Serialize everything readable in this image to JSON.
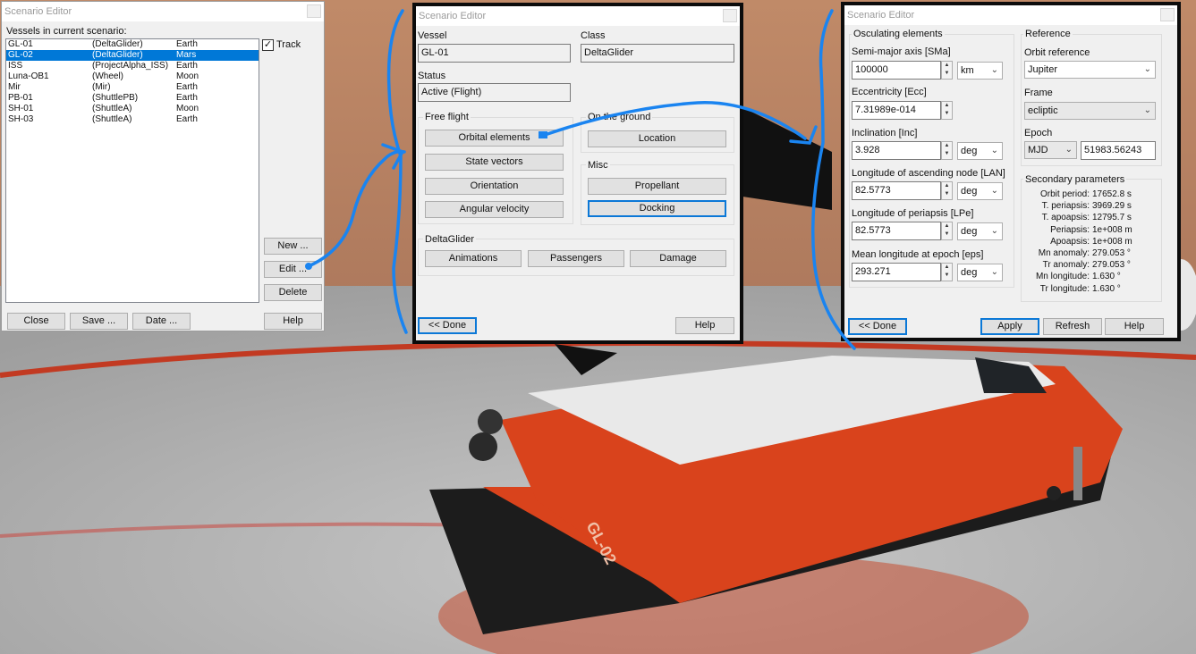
{
  "colors": {
    "accent": "#0078d7",
    "annotation": "#1a84f0",
    "hull": "#d9431c"
  },
  "dialog1": {
    "title": "Scenario Editor",
    "list_caption": "Vessels in current scenario:",
    "vessels": [
      {
        "name": "GL-01",
        "cls": "(DeltaGlider)",
        "body": "Earth",
        "selected": false
      },
      {
        "name": "GL-02",
        "cls": "(DeltaGlider)",
        "body": "Mars",
        "selected": true
      },
      {
        "name": "ISS",
        "cls": "(ProjectAlpha_ISS)",
        "body": "Earth",
        "selected": false
      },
      {
        "name": "Luna-OB1",
        "cls": "(Wheel)",
        "body": "Moon",
        "selected": false
      },
      {
        "name": "Mir",
        "cls": "(Mir)",
        "body": "Earth",
        "selected": false
      },
      {
        "name": "PB-01",
        "cls": "(ShuttlePB)",
        "body": "Earth",
        "selected": false
      },
      {
        "name": "SH-01",
        "cls": "(ShuttleA)",
        "body": "Moon",
        "selected": false
      },
      {
        "name": "SH-03",
        "cls": "(ShuttleA)",
        "body": "Earth",
        "selected": false
      }
    ],
    "track_label": "Track",
    "track_checked": "✓",
    "buttons": {
      "new": "New ...",
      "edit": "Edit ...",
      "delete": "Delete",
      "close": "Close",
      "save": "Save ...",
      "date": "Date ...",
      "help": "Help"
    }
  },
  "dialog2": {
    "title": "Scenario Editor",
    "vessel_label": "Vessel",
    "vessel_value": "GL-01",
    "class_label": "Class",
    "class_value": "DeltaGlider",
    "status_label": "Status",
    "status_value": "Active (Flight)",
    "free_flight": "Free flight",
    "on_ground": "On the ground",
    "misc": "Misc",
    "deltaglider": "DeltaGlider",
    "buttons": {
      "orbital": "Orbital elements",
      "state": "State vectors",
      "orientation": "Orientation",
      "angular": "Angular velocity",
      "location": "Location",
      "propellant": "Propellant",
      "docking": "Docking",
      "animations": "Animations",
      "passengers": "Passengers",
      "damage": "Damage",
      "done": "<< Done",
      "help": "Help"
    }
  },
  "dialog3": {
    "title": "Scenario Editor",
    "osc_title": "Osculating elements",
    "sma_label": "Semi-major axis [SMa]",
    "sma_value": "100000",
    "sma_unit": "km",
    "ecc_label": "Eccentricity [Ecc]",
    "ecc_value": "7.31989e-014",
    "inc_label": "Inclination [Inc]",
    "inc_value": "3.928",
    "inc_unit": "deg",
    "lan_label": "Longitude of ascending node [LAN]",
    "lan_value": "82.5773",
    "lan_unit": "deg",
    "lpe_label": "Longitude of periapsis [LPe]",
    "lpe_value": "82.5773",
    "lpe_unit": "deg",
    "eps_label": "Mean longitude at epoch [eps]",
    "eps_value": "293.271",
    "eps_unit": "deg",
    "ref_title": "Reference",
    "orbit_ref_label": "Orbit reference",
    "orbit_ref_value": "Jupiter",
    "frame_label": "Frame",
    "frame_value": "ecliptic",
    "epoch_label": "Epoch",
    "epoch_type": "MJD",
    "epoch_value": "51983.56243",
    "sec_title": "Secondary parameters",
    "secondary": [
      {
        "k": "Orbit period:",
        "v": "17652.8 s"
      },
      {
        "k": "T. periapsis:",
        "v": "3969.29 s"
      },
      {
        "k": "T. apoapsis:",
        "v": "12795.7 s"
      },
      {
        "k": "Periapsis:",
        "v": "1e+008 m"
      },
      {
        "k": "Apoapsis:",
        "v": "1e+008 m"
      },
      {
        "k": "Mn anomaly:",
        "v": "279.053 °"
      },
      {
        "k": "Tr anomaly:",
        "v": "279.053 °"
      },
      {
        "k": "Mn longitude:",
        "v": "1.630 °"
      },
      {
        "k": "Tr longitude:",
        "v": "1.630 °"
      }
    ],
    "buttons": {
      "done": "<< Done",
      "apply": "Apply",
      "refresh": "Refresh",
      "help": "Help"
    }
  },
  "ship_label": "GL-02"
}
